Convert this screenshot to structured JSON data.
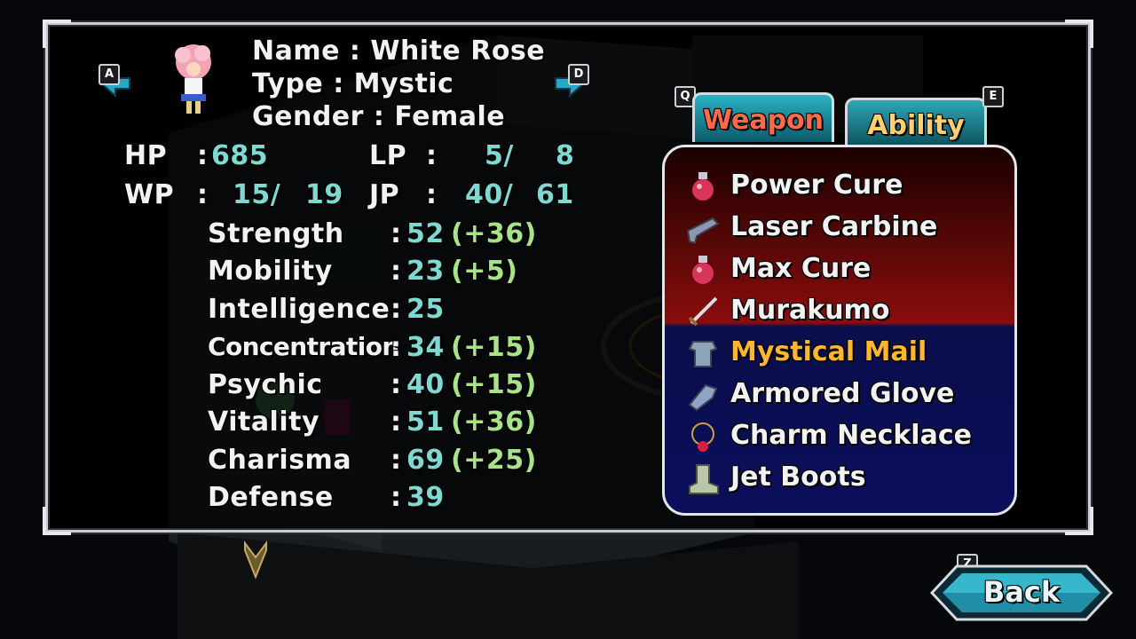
{
  "character": {
    "name_label": "Name",
    "name": "White Rose",
    "type_label": "Type",
    "type": "Mystic",
    "gender_label": "Gender",
    "gender": "Female",
    "prev_key": "A",
    "next_key": "D"
  },
  "vitals": {
    "hp_label": "HP",
    "hp_value": "685",
    "lp_label": "LP",
    "lp_current": "5/",
    "lp_max": "8",
    "wp_label": "WP",
    "wp_current": "15/",
    "wp_max": "19",
    "jp_label": "JP",
    "jp_current": "40/",
    "jp_max": "61"
  },
  "stats": [
    {
      "label": "Strength",
      "value": "52",
      "bonus": "(+36)"
    },
    {
      "label": "Mobility",
      "value": "23",
      "bonus": "(+5)"
    },
    {
      "label": "Intelligence",
      "value": "25",
      "bonus": ""
    },
    {
      "label": "Concentration",
      "value": "34",
      "bonus": "(+15)"
    },
    {
      "label": "Psychic",
      "value": "40",
      "bonus": "(+15)"
    },
    {
      "label": "Vitality",
      "value": "51",
      "bonus": "(+36)"
    },
    {
      "label": "Charisma",
      "value": "69",
      "bonus": "(+25)"
    },
    {
      "label": "Defense",
      "value": "39",
      "bonus": ""
    }
  ],
  "tabs": {
    "left_key": "Q",
    "right_key": "E",
    "weapon_label": "Weapon",
    "ability_label": "Ability"
  },
  "items": [
    {
      "label": "Power Cure",
      "icon": "potion-icon",
      "color": "#ffffff"
    },
    {
      "label": "Laser Carbine",
      "icon": "gun-icon",
      "color": "#ffffff"
    },
    {
      "label": "Max Cure",
      "icon": "potion-icon",
      "color": "#ffffff"
    },
    {
      "label": "Murakumo",
      "icon": "sword-icon",
      "color": "#ffffff"
    },
    {
      "label": "Mystical Mail",
      "icon": "armor-icon",
      "color": "#ffb733"
    },
    {
      "label": "Armored Glove",
      "icon": "glove-icon",
      "color": "#ffffff"
    },
    {
      "label": "Charm Necklace",
      "icon": "necklace-icon",
      "color": "#ffffff"
    },
    {
      "label": "Jet Boots",
      "icon": "boots-icon",
      "color": "#ffffff"
    }
  ],
  "back": {
    "key": "Z",
    "label": "Back"
  },
  "colors": {
    "stat_value": "#7fd9d3",
    "stat_bonus": "#a8e38a",
    "highlight_item": "#ffb733"
  }
}
